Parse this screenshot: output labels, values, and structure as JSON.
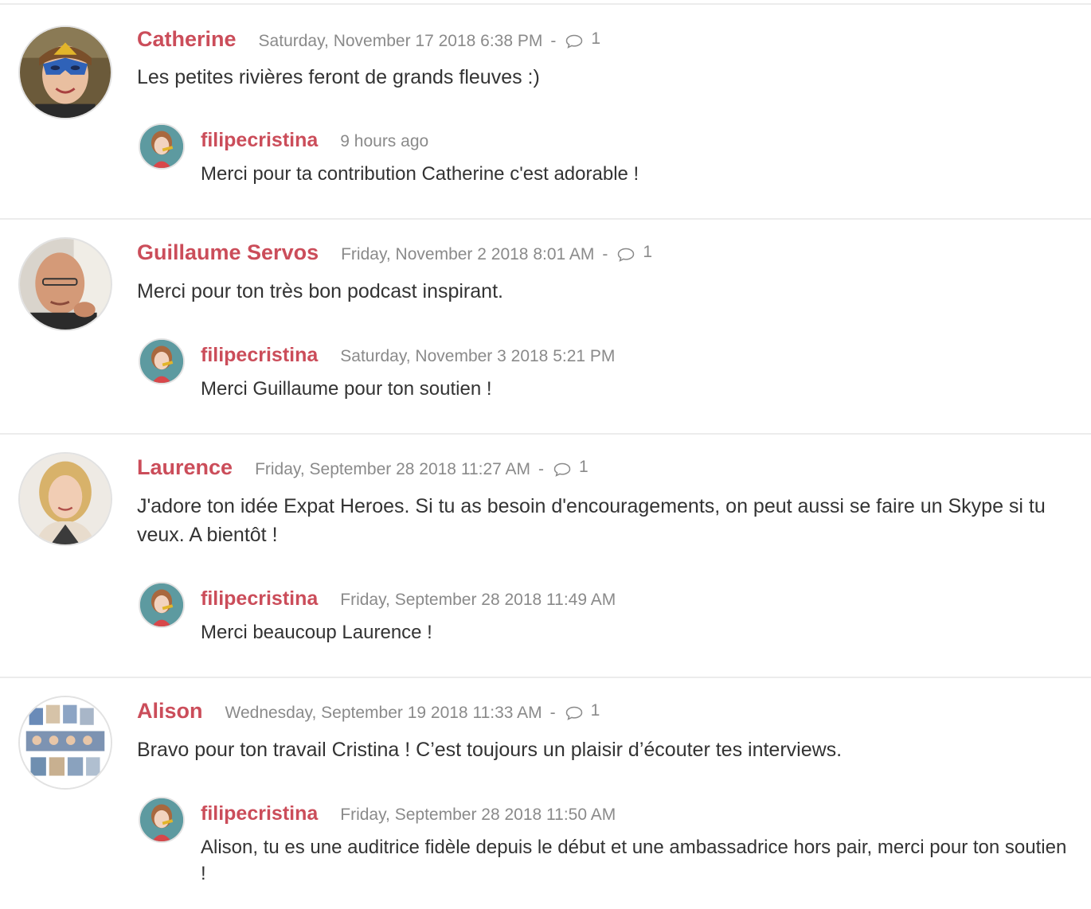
{
  "comments": [
    {
      "author": "Catherine",
      "date": "Saturday, November 17 2018 6:38 PM",
      "separator": "-",
      "reply_count": "1",
      "text": "Les petites rivières feront de grands fleuves :)",
      "reply": {
        "author": "filipecristina",
        "date": "9 hours ago",
        "text": "Merci pour ta contribution Catherine c'est adorable !"
      }
    },
    {
      "author": "Guillaume Servos",
      "date": "Friday, November 2 2018 8:01 AM",
      "separator": "-",
      "reply_count": "1",
      "text": "Merci pour ton très bon podcast inspirant.",
      "reply": {
        "author": "filipecristina",
        "date": "Saturday, November 3 2018 5:21 PM",
        "text": "Merci Guillaume pour ton soutien !"
      }
    },
    {
      "author": "Laurence",
      "date": "Friday, September 28 2018 11:27 AM",
      "separator": "-",
      "reply_count": "1",
      "text": "J'adore ton idée Expat Heroes. Si tu as besoin d'encouragements, on peut aussi se faire un Skype si tu veux. A bientôt !",
      "reply": {
        "author": "filipecristina",
        "date": "Friday, September 28 2018 11:49 AM",
        "text": "Merci beaucoup Laurence !"
      }
    },
    {
      "author": "Alison",
      "date": "Wednesday, September 19 2018 11:33 AM",
      "separator": "-",
      "reply_count": "1",
      "text": "Bravo pour ton travail Cristina ! C’est toujours un plaisir d’écouter tes interviews.",
      "reply": {
        "author": "filipecristina",
        "date": "Friday, September 28 2018 11:50 AM",
        "text": "Alison, tu es une auditrice fidèle depuis le début et une ambassadrice hors pair, merci pour ton soutien !"
      }
    }
  ],
  "colors": {
    "author": "#cb4d5a",
    "meta": "#8a8a8a",
    "text": "#333333",
    "divider": "#ececec"
  },
  "icons": {
    "reply_count": "speech-bubble-icon"
  }
}
